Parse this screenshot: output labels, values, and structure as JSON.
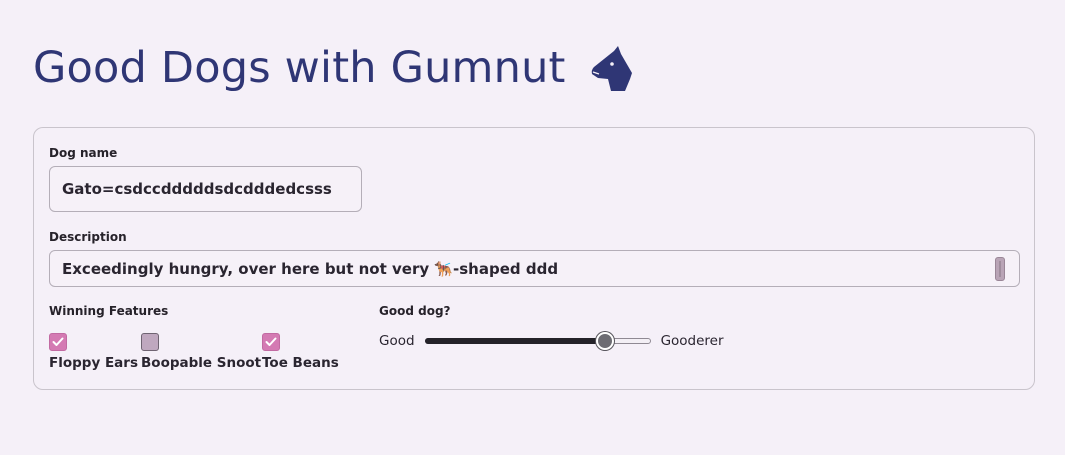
{
  "header": {
    "title": "Good Dogs with Gumnut",
    "logo_icon": "dog-head-icon",
    "title_color": "#2f3675"
  },
  "form": {
    "dog_name": {
      "label": "Dog name",
      "value": "Gato=csdccdddddsdcdddedcsss"
    },
    "description": {
      "label": "Description",
      "value": "Exceedingly hungry, over here but not very 🐕‍🦺-shaped ddd"
    },
    "winning_features": {
      "label": "Winning Features",
      "items": [
        {
          "label": "Floppy Ears",
          "checked": true
        },
        {
          "label": "Boopable Snoot",
          "checked": false
        },
        {
          "label": "Toe Beans",
          "checked": true
        }
      ],
      "checked_color": "#d47ab3",
      "unchecked_color": "#bfa8bf"
    },
    "good_dog": {
      "label": "Good dog?",
      "min_label": "Good",
      "max_label": "Gooderer",
      "value": 0.8
    }
  }
}
